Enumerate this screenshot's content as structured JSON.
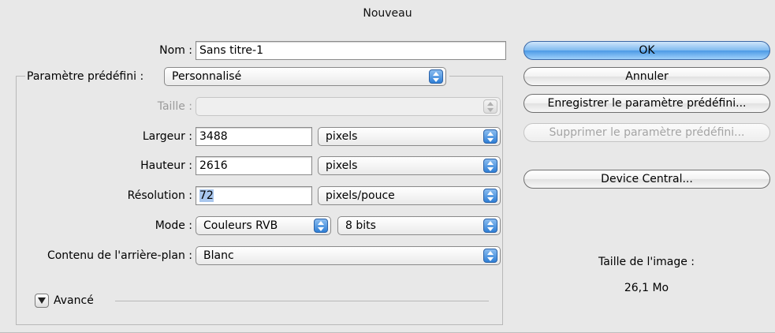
{
  "dialog": {
    "title": "Nouveau",
    "name_label": "Nom :",
    "name_value": "Sans titre-1",
    "preset_label": "Paramètre prédéfini :",
    "preset_value": "Personnalisé",
    "size_label": "Taille :",
    "size_value": "",
    "width_label": "Largeur :",
    "width_value": "3488",
    "width_unit": "pixels",
    "height_label": "Hauteur :",
    "height_value": "2616",
    "height_unit": "pixels",
    "resolution_label": "Résolution :",
    "resolution_value": "72",
    "resolution_unit": "pixels/pouce",
    "mode_label": "Mode :",
    "mode_value": "Couleurs RVB",
    "depth_value": "8 bits",
    "background_label": "Contenu de l'arrière-plan :",
    "background_value": "Blanc",
    "advanced_label": "Avancé"
  },
  "buttons": {
    "ok": "OK",
    "cancel": "Annuler",
    "save_preset": "Enregistrer le paramètre prédéfini...",
    "delete_preset": "Supprimer le paramètre prédéfini...",
    "device_central": "Device Central..."
  },
  "image_size": {
    "label": "Taille de l'image :",
    "value": "26,1 Mo"
  },
  "colors": {
    "default_button": "#6aaef0",
    "selection": "#a9c7ee",
    "popup_arrows": "#2f7fd6"
  }
}
